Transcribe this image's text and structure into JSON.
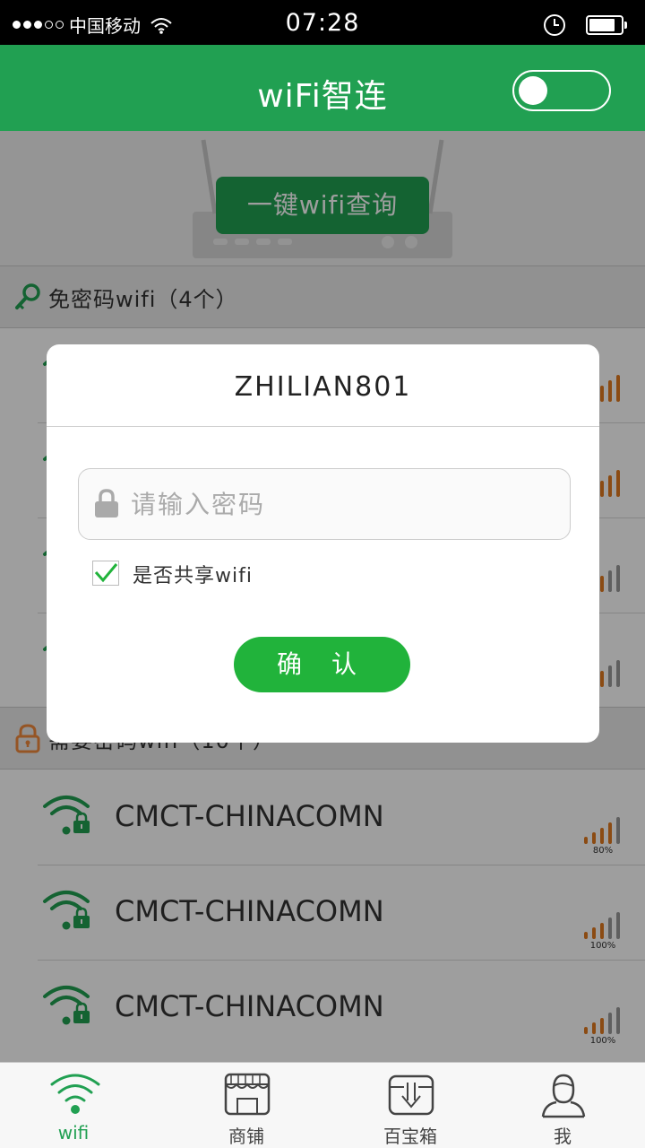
{
  "status_bar": {
    "carrier": "中国移动",
    "time": "07:28"
  },
  "header": {
    "title": "wiFi智连",
    "toggle_on": false
  },
  "banner": {
    "query_button": "一键wifi查询"
  },
  "free_section": {
    "label": "免密码wifi（4个）"
  },
  "locked_section": {
    "label": "需要密码wifi（10个）"
  },
  "networks": [
    {
      "name": "CMCT-CHINACOMN",
      "signal": "80%"
    },
    {
      "name": "CMCT-CHINACOMN",
      "signal": "100%"
    },
    {
      "name": "CMCT-CHINACOMN",
      "signal": "100%"
    }
  ],
  "dialog": {
    "title": "ZHILIAN801",
    "password_placeholder": "请输入密码",
    "share_label": "是否共享wifi",
    "share_checked": true,
    "confirm": "确 认"
  },
  "tabs": [
    {
      "label": "wifi",
      "icon": "wifi-icon",
      "active": true
    },
    {
      "label": "商铺",
      "icon": "shop-icon",
      "active": false
    },
    {
      "label": "百宝箱",
      "icon": "toolbox-icon",
      "active": false
    },
    {
      "label": "我",
      "icon": "user-icon",
      "active": false
    }
  ],
  "colors": {
    "primary": "#21a052",
    "confirm": "#21b33b",
    "signal": "#e07a1f",
    "lock": "#f08a3c"
  }
}
